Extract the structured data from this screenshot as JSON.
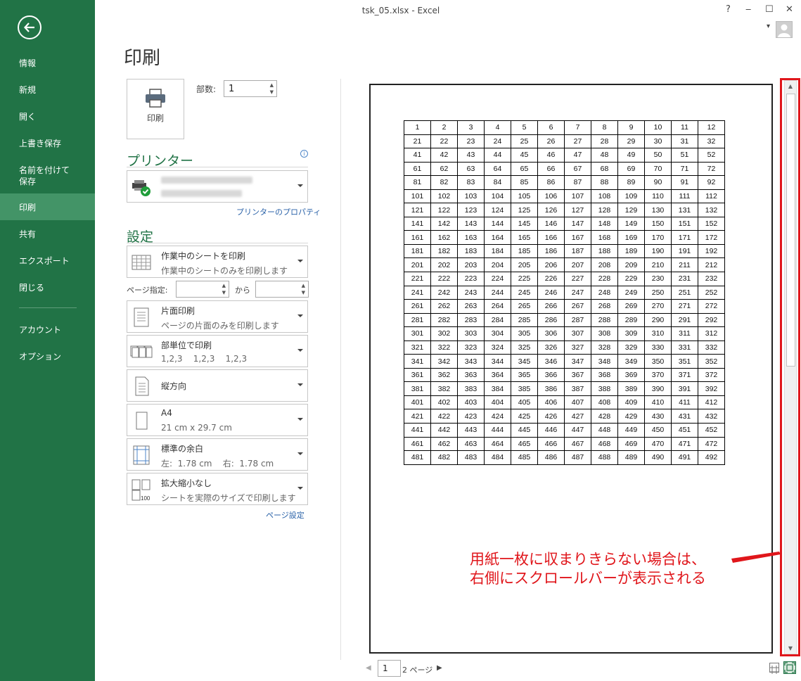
{
  "window": {
    "title": "tsk_05.xlsx - Excel",
    "help": "?",
    "minimize": "‒",
    "maximize": "☐",
    "close": "✕",
    "dropdown": "▾"
  },
  "nav": {
    "items": [
      {
        "label": "情報"
      },
      {
        "label": "新規"
      },
      {
        "label": "開く"
      },
      {
        "label": "上書き保存"
      },
      {
        "label": "名前を付けて\n保存"
      },
      {
        "label": "印刷"
      },
      {
        "label": "共有"
      },
      {
        "label": "エクスポート"
      },
      {
        "label": "閉じる"
      },
      {
        "label": "アカウント"
      },
      {
        "label": "オプション"
      }
    ]
  },
  "print": {
    "heading": "印刷",
    "button_label": "印刷",
    "copies_label": "部数:",
    "copies_value": "1"
  },
  "printer": {
    "heading": "プリンター",
    "properties_link": "プリンターのプロパティ"
  },
  "settings": {
    "heading": "設定",
    "what": {
      "line1": "作業中のシートを印刷",
      "line2": "作業中のシートのみを印刷します"
    },
    "pages_label": "ページ指定:",
    "pages_to": "から",
    "sides": {
      "line1": "片面印刷",
      "line2": "ページの片面のみを印刷します"
    },
    "collate": {
      "line1": "部単位で印刷",
      "line2": "1,2,3    1,2,3    1,2,3"
    },
    "orientation": {
      "line1": "縦方向"
    },
    "paper": {
      "line1": "A4",
      "line2": "21 cm x 29.7 cm"
    },
    "margins": {
      "line1": "標準の余白",
      "line2": "左:  1.78 cm    右:  1.78 cm"
    },
    "scaling": {
      "line1": "拡大縮小なし",
      "line2": "シートを実際のサイズで印刷します"
    },
    "page_setup_link": "ページ設定"
  },
  "preview": {
    "table": [
      [
        "1",
        "2",
        "3",
        "4",
        "5",
        "6",
        "7",
        "8",
        "9",
        "10",
        "11",
        "12"
      ],
      [
        "21",
        "22",
        "23",
        "24",
        "25",
        "26",
        "27",
        "28",
        "29",
        "30",
        "31",
        "32"
      ],
      [
        "41",
        "42",
        "43",
        "44",
        "45",
        "46",
        "47",
        "48",
        "49",
        "50",
        "51",
        "52"
      ],
      [
        "61",
        "62",
        "63",
        "64",
        "65",
        "66",
        "67",
        "68",
        "69",
        "70",
        "71",
        "72"
      ],
      [
        "81",
        "82",
        "83",
        "84",
        "85",
        "86",
        "87",
        "88",
        "89",
        "90",
        "91",
        "92"
      ],
      [
        "101",
        "102",
        "103",
        "104",
        "105",
        "106",
        "107",
        "108",
        "109",
        "110",
        "111",
        "112"
      ],
      [
        "121",
        "122",
        "123",
        "124",
        "125",
        "126",
        "127",
        "128",
        "129",
        "130",
        "131",
        "132"
      ],
      [
        "141",
        "142",
        "143",
        "144",
        "145",
        "146",
        "147",
        "148",
        "149",
        "150",
        "151",
        "152"
      ],
      [
        "161",
        "162",
        "163",
        "164",
        "165",
        "166",
        "167",
        "168",
        "169",
        "170",
        "171",
        "172"
      ],
      [
        "181",
        "182",
        "183",
        "184",
        "185",
        "186",
        "187",
        "188",
        "189",
        "190",
        "191",
        "192"
      ],
      [
        "201",
        "202",
        "203",
        "204",
        "205",
        "206",
        "207",
        "208",
        "209",
        "210",
        "211",
        "212"
      ],
      [
        "221",
        "222",
        "223",
        "224",
        "225",
        "226",
        "227",
        "228",
        "229",
        "230",
        "231",
        "232"
      ],
      [
        "241",
        "242",
        "243",
        "244",
        "245",
        "246",
        "247",
        "248",
        "249",
        "250",
        "251",
        "252"
      ],
      [
        "261",
        "262",
        "263",
        "264",
        "265",
        "266",
        "267",
        "268",
        "269",
        "270",
        "271",
        "272"
      ],
      [
        "281",
        "282",
        "283",
        "284",
        "285",
        "286",
        "287",
        "288",
        "289",
        "290",
        "291",
        "292"
      ],
      [
        "301",
        "302",
        "303",
        "304",
        "305",
        "306",
        "307",
        "308",
        "309",
        "310",
        "311",
        "312"
      ],
      [
        "321",
        "322",
        "323",
        "324",
        "325",
        "326",
        "327",
        "328",
        "329",
        "330",
        "331",
        "332"
      ],
      [
        "341",
        "342",
        "343",
        "344",
        "345",
        "346",
        "347",
        "348",
        "349",
        "350",
        "351",
        "352"
      ],
      [
        "361",
        "362",
        "363",
        "364",
        "365",
        "366",
        "367",
        "368",
        "369",
        "370",
        "371",
        "372"
      ],
      [
        "381",
        "382",
        "383",
        "384",
        "385",
        "386",
        "387",
        "388",
        "389",
        "390",
        "391",
        "392"
      ],
      [
        "401",
        "402",
        "403",
        "404",
        "405",
        "406",
        "407",
        "408",
        "409",
        "410",
        "411",
        "412"
      ],
      [
        "421",
        "422",
        "423",
        "424",
        "425",
        "426",
        "427",
        "428",
        "429",
        "430",
        "431",
        "432"
      ],
      [
        "441",
        "442",
        "443",
        "444",
        "445",
        "446",
        "447",
        "448",
        "449",
        "450",
        "451",
        "452"
      ],
      [
        "461",
        "462",
        "463",
        "464",
        "465",
        "466",
        "467",
        "468",
        "469",
        "470",
        "471",
        "472"
      ],
      [
        "481",
        "482",
        "483",
        "484",
        "485",
        "486",
        "487",
        "488",
        "489",
        "490",
        "491",
        "492"
      ]
    ],
    "annotation_line1": "用紙一枚に収まりきらない場合は、",
    "annotation_line2": "右側にスクロールバーが表示される",
    "page_current": "1",
    "page_total": "2 ページ"
  },
  "colors": {
    "nav_bg": "#217346",
    "nav_active": "#439467",
    "accent_green": "#217346",
    "annotation_red": "#e0161b",
    "link_blue": "#2a62a8"
  }
}
